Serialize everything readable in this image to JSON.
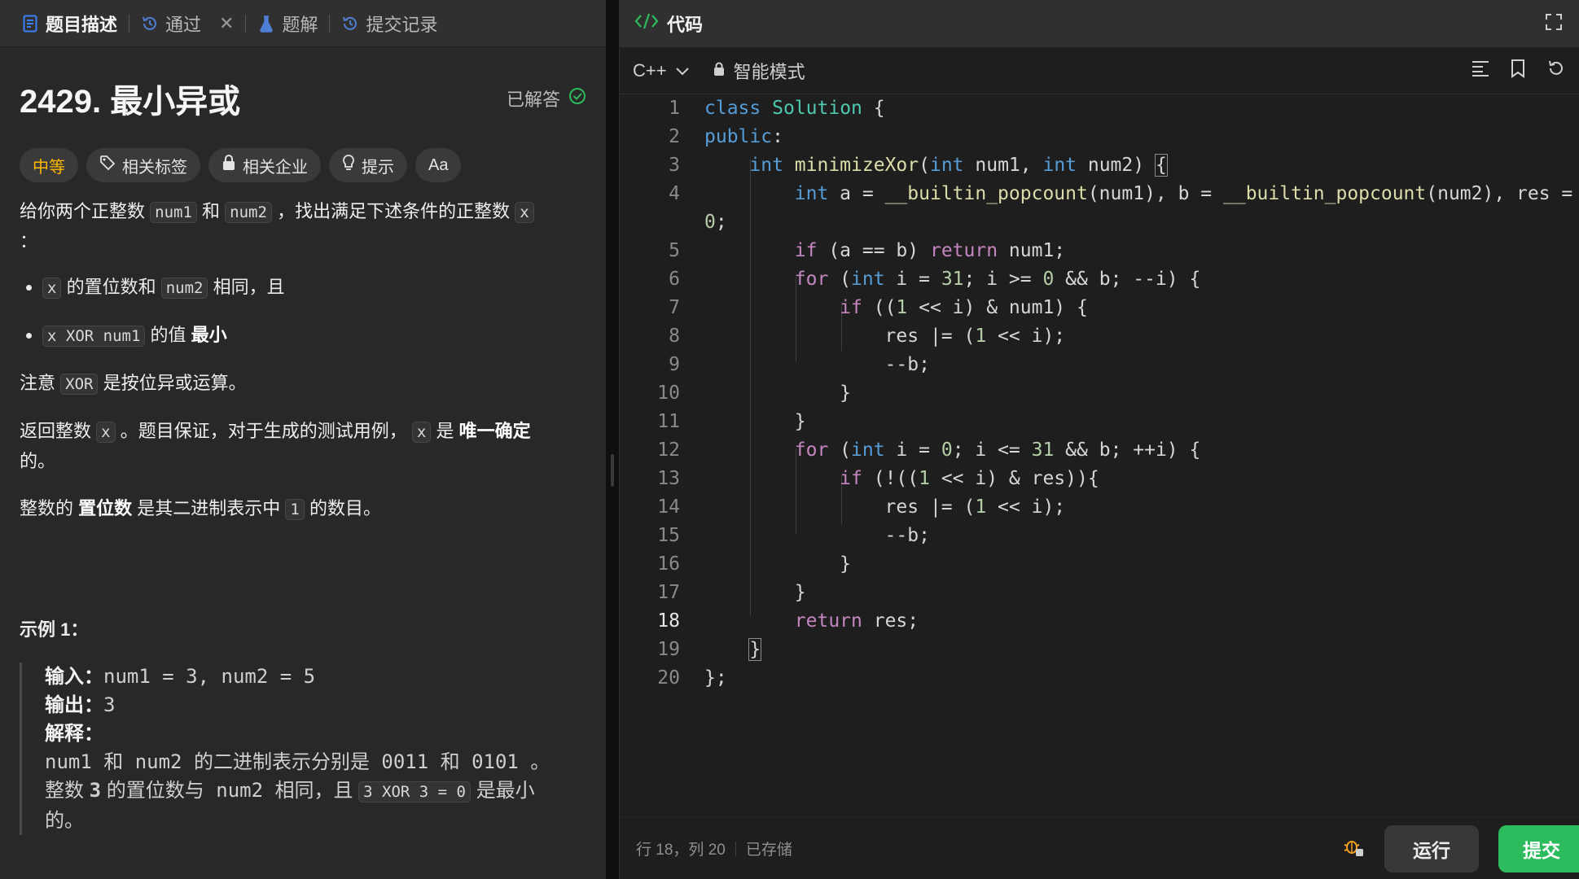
{
  "left_tabs": [
    {
      "label": "题目描述",
      "icon": "description-icon",
      "active": true
    },
    {
      "label": "通过",
      "icon": "history-icon",
      "active": false
    },
    {
      "label": "题解",
      "icon": "flask-icon",
      "active": false
    },
    {
      "label": "提交记录",
      "icon": "history-icon",
      "active": false
    }
  ],
  "problem": {
    "title": "2429. 最小异或",
    "status": "已解答",
    "difficulty": "中等",
    "chips": [
      "相关标签",
      "相关企业",
      "提示",
      "Aa"
    ],
    "desc_1": "给你两个正整数",
    "code_num1": "num1",
    "and": "和",
    "code_num2": "num2",
    "desc_1_tail": "，找出满足下述条件的正整数",
    "code_x": "x",
    "colon": "：",
    "bullet1_mid": "的置位数和",
    "bullet1_tail": "相同，且",
    "bullet2_code": "x XOR num1",
    "bullet2_mid": "的值",
    "bullet2_bold": "最小",
    "note_head": "注意",
    "code_xor": "XOR",
    "note_tail": "是按位异或运算。",
    "ret_head": "返回整数",
    "ret_mid": "。题目保证，对于生成的测试用例，",
    "ret_is": "是",
    "ret_bold": "唯一确定",
    "ret_tail": "的。",
    "setbits_head": "整数的",
    "setbits_bold": "置位数",
    "setbits_mid": "是其二进制表示中",
    "code_1": "1",
    "setbits_tail": "的数目。",
    "example_title": "示例 1：",
    "ex_input_label": "输入：",
    "ex_input": "num1 = 3, num2 = 5",
    "ex_output_label": "输出：",
    "ex_output": "3",
    "ex_explain_label": "解释：",
    "ex_line1": "num1 和 num2 的二进制表示分别是 0011 和 0101 。",
    "ex_line2_head": "整数",
    "ex_line2_bold": "3",
    "ex_line2_mid": "的置位数与 num2 相同，且",
    "ex_line2_code": "3 XOR 3 = 0",
    "ex_line2_tail": "是最小",
    "ex_line3": "的。"
  },
  "editor": {
    "panel_title": "代码",
    "language": "C++",
    "mode": "智能模式",
    "status_pos": "行 18，列 20",
    "status_saved": "已存储",
    "run_label": "运行",
    "submit_label": "提交",
    "current_line": 18,
    "line_numbers": [
      "1",
      "2",
      "3",
      "4",
      "",
      "5",
      "6",
      "7",
      "8",
      "9",
      "10",
      "11",
      "12",
      "13",
      "14",
      "15",
      "16",
      "17",
      "18",
      "19",
      "20"
    ]
  }
}
